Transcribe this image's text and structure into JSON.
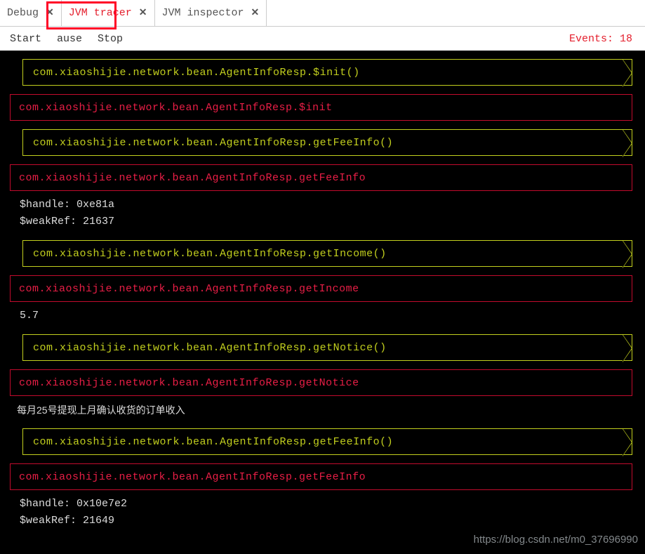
{
  "tabs": [
    {
      "label": "Debug"
    },
    {
      "label": "JVM tracer"
    },
    {
      "label": "JVM inspector"
    }
  ],
  "toolbar": {
    "start": "Start",
    "pause": "ause",
    "stop": "Stop"
  },
  "events_label": "Events: 18",
  "trace": {
    "items": [
      {
        "type": "call",
        "text": "com.xiaoshijie.network.bean.AgentInfoResp.$init()"
      },
      {
        "type": "ret",
        "text": "com.xiaoshijie.network.bean.AgentInfoResp.$init"
      },
      {
        "type": "call",
        "text": "com.xiaoshijie.network.bean.AgentInfoResp.getFeeInfo()"
      },
      {
        "type": "ret",
        "text": "com.xiaoshijie.network.bean.AgentInfoResp.getFeeInfo"
      },
      {
        "type": "detail",
        "text": "$handle: 0xe81a\n$weakRef: 21637"
      },
      {
        "type": "call",
        "text": "com.xiaoshijie.network.bean.AgentInfoResp.getIncome()"
      },
      {
        "type": "ret",
        "text": "com.xiaoshijie.network.bean.AgentInfoResp.getIncome"
      },
      {
        "type": "detail",
        "text": "5.7"
      },
      {
        "type": "call",
        "text": "com.xiaoshijie.network.bean.AgentInfoResp.getNotice()"
      },
      {
        "type": "ret",
        "text": "com.xiaoshijie.network.bean.AgentInfoResp.getNotice"
      },
      {
        "type": "detail_cn",
        "text": "每月25号提现上月确认收货的订单收入"
      },
      {
        "type": "call",
        "text": "com.xiaoshijie.network.bean.AgentInfoResp.getFeeInfo()"
      },
      {
        "type": "ret",
        "text": "com.xiaoshijie.network.bean.AgentInfoResp.getFeeInfo"
      },
      {
        "type": "detail",
        "text": "$handle: 0x10e7e2\n$weakRef: 21649"
      }
    ]
  },
  "watermark": "https://blog.csdn.net/m0_37696990"
}
